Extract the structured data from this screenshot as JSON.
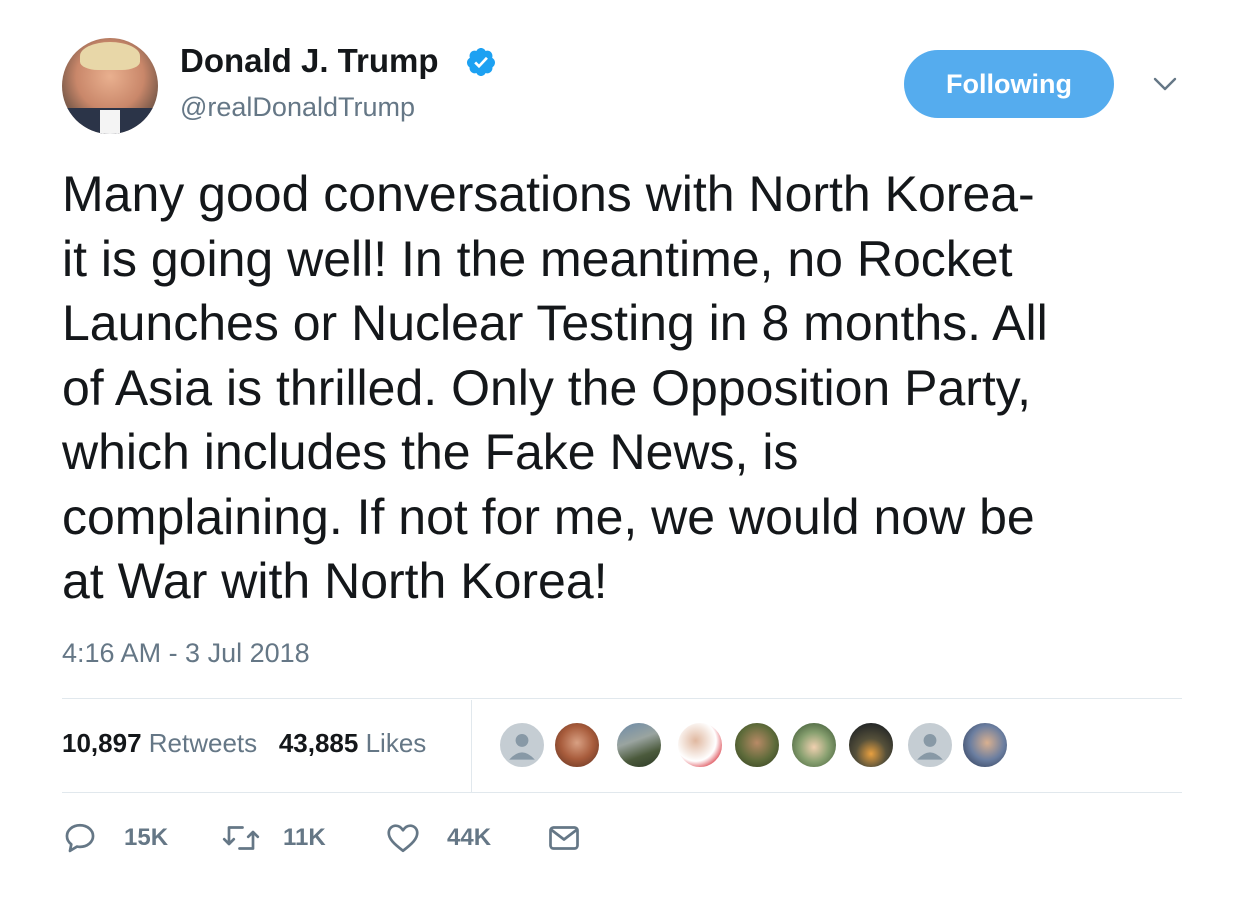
{
  "author": {
    "name": "Donald J. Trump",
    "handle": "@realDonaldTrump",
    "verified_icon": "verified-badge-icon"
  },
  "follow_button_label": "Following",
  "tweet": {
    "lines": [
      "Many good conversations with North Korea-",
      "it is going well! In the meantime, no Rocket",
      "Launches or Nuclear Testing in 8 months. All",
      "of Asia is thrilled. Only the Opposition Party,",
      "which includes the Fake News, is",
      "complaining. If not for me, we would now be",
      "at War with North Korea!"
    ],
    "timestamp": "4:16 AM - 3 Jul 2018"
  },
  "stats": {
    "retweets_count": "10,897",
    "retweets_label": "Retweets",
    "likes_count": "43,885",
    "likes_label": "Likes"
  },
  "actions": {
    "reply_count": "15K",
    "retweet_count": "11K",
    "like_count": "44K"
  },
  "colors": {
    "accent": "#55acee",
    "verified": "#1da1f2",
    "secondary_text": "#657786",
    "divider": "#e1e8ed"
  }
}
